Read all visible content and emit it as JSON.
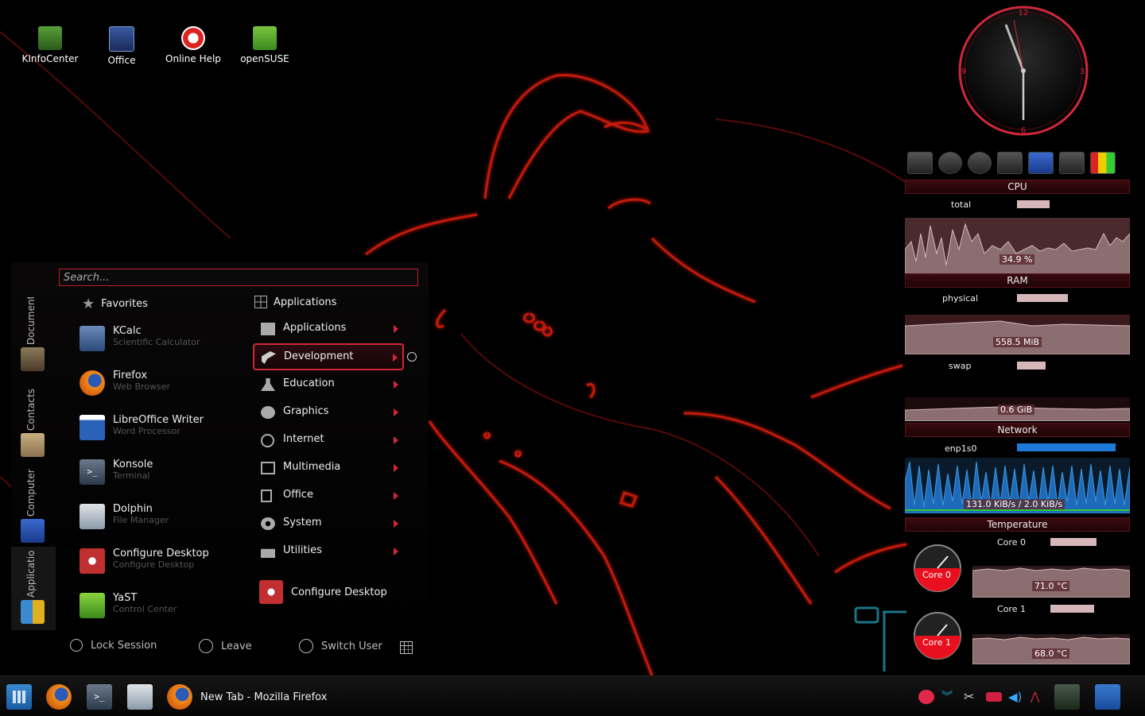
{
  "desktop": {
    "icons": [
      {
        "label": "KInfoCenter",
        "icon": "kinfocenter-icon",
        "color": "#3b8d2a"
      },
      {
        "label": "Office",
        "icon": "office-icon",
        "color": "#2a4a8a"
      },
      {
        "label": "Online Help",
        "icon": "help-lifebuoy-icon",
        "color": "#d22"
      },
      {
        "label": "openSUSE",
        "icon": "opensuse-icon",
        "color": "#6ab42d"
      }
    ]
  },
  "clock": {
    "numerals": [
      "12",
      "3",
      "6",
      "9"
    ]
  },
  "monitor": {
    "cpu": {
      "header": "CPU",
      "label": "total",
      "value_text": "34.9 %",
      "level": 0.349
    },
    "ram": {
      "header": "RAM",
      "physical_label": "physical",
      "physical_text": "558.5 MiB",
      "swap_label": "swap",
      "swap_text": "0.6 GiB"
    },
    "network": {
      "header": "Network",
      "interface": "enp1s0",
      "rate_text": "131.0 KiB/s / 2.0 KiB/s"
    },
    "temperature": {
      "header": "Temperature",
      "cores": [
        {
          "label": "Core 0",
          "gauge_label": "Core 0",
          "value_text": "71.0 °C"
        },
        {
          "label": "Core 1",
          "gauge_label": "Core 1",
          "value_text": "68.0 °C"
        }
      ]
    }
  },
  "menu": {
    "search_placeholder": "Search...",
    "side_tabs": [
      "Documents",
      "Contacts",
      "Computer",
      "Applications"
    ],
    "favorites_title": "Favorites",
    "applications_title": "Applications",
    "favorites": [
      {
        "name": "KCalc",
        "desc": "Scientific Calculator",
        "icon": "calculator-icon",
        "color": "#4a6a9a"
      },
      {
        "name": "Firefox",
        "desc": "Web Browser",
        "icon": "firefox-icon",
        "color": "#e8761a"
      },
      {
        "name": "LibreOffice Writer",
        "desc": "Word Processor",
        "icon": "writer-icon",
        "color": "#2a62b8"
      },
      {
        "name": "Konsole",
        "desc": "Terminal",
        "icon": "terminal-icon",
        "color": "#3a4a5a"
      },
      {
        "name": "Dolphin",
        "desc": "File Manager",
        "icon": "folder-icon",
        "color": "#b0b8c0"
      },
      {
        "name": "Configure Desktop",
        "desc": "Configure Desktop",
        "icon": "settings-gear-icon",
        "color": "#c03030"
      },
      {
        "name": "YaST",
        "desc": "Control Center",
        "icon": "yast-icon",
        "color": "#6ab42d"
      }
    ],
    "categories": [
      {
        "name": "Applications",
        "icon": "applications-icon"
      },
      {
        "name": "Development",
        "icon": "development-hammer-icon"
      },
      {
        "name": "Education",
        "icon": "education-flask-icon"
      },
      {
        "name": "Graphics",
        "icon": "graphics-palette-icon"
      },
      {
        "name": "Internet",
        "icon": "internet-globe-icon"
      },
      {
        "name": "Multimedia",
        "icon": "multimedia-icon"
      },
      {
        "name": "Office",
        "icon": "office-doc-icon"
      },
      {
        "name": "System",
        "icon": "system-gear-icon"
      },
      {
        "name": "Utilities",
        "icon": "utilities-icon"
      }
    ],
    "configure_desktop": "Configure Desktop",
    "footer": {
      "lock": "Lock Session",
      "leave": "Leave",
      "switch_user": "Switch User"
    }
  },
  "taskbar": {
    "active_task": "New Tab - Mozilla Firefox"
  },
  "colors": {
    "accent": "#d0283a",
    "network": "#1e7ad8",
    "graph_fill": "#8a6e70"
  }
}
